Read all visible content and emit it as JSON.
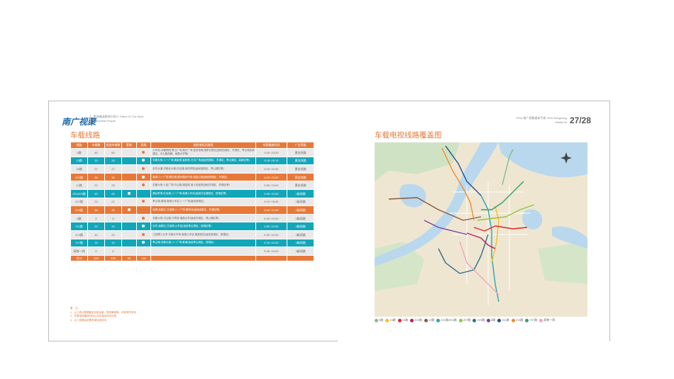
{
  "left_page": {
    "logo": "南广视聚",
    "logo_sub": "影响最具影响力的人 Effect Of The Most Influential People",
    "title": "车载线路",
    "table": {
      "headers": [
        "线路",
        "车辆数",
        "投放车辆数",
        "套装",
        "双屏",
        "途经地标及路段",
        "车载播放时间",
        "广告等级"
      ],
      "rows": [
        {
          "cls": "gray",
          "line": "5路",
          "a": "60",
          "b": "60",
          "c": "",
          "d": "●",
          "route": "火车站-动植物园-蒙山广场-鼎元广场-金亚传媒-国泰日报社(途经西湖区、东湖区、青山湖区新建区、中山路商圈、南昌大学等)",
          "time": "5:20~23:30",
          "grade": "黄金线路"
        },
        {
          "cls": "teal",
          "line": "13路",
          "a": "33",
          "b": "33",
          "c": "",
          "d": "●",
          "route": "洪都大桥-八一广场-绳金塔-省政府-万达广场(途经西湖区、东湖区、青山湖区、高新区等)",
          "time": "5:15~20:10",
          "grade": "黄金线路"
        },
        {
          "cls": "gray",
          "line": "16路",
          "a": "37",
          "b": "27",
          "c": "",
          "d": "●",
          "route": "京东大道-洪都北大道-红谷滩-省体育馆(途经高新区、青山湖区等)",
          "time": "6:10~22:30",
          "grade": "黄金线路"
        },
        {
          "cls": "orange",
          "line": "202路",
          "a": "30",
          "b": "30",
          "c": "",
          "d": "●",
          "route": "象湖-八一广场-滕王阁-胜利路步行街-瑞金公园(途经西湖区、东湖区)",
          "time": "6:15~22:30",
          "grade": "黄金线路"
        },
        {
          "cls": "gray",
          "line": "12路",
          "a": "22",
          "b": "25",
          "c": "",
          "d": "●",
          "route": "洪都大桥-人民广场-中山路-绳金塔-省人民医院(途经东湖区、西湖区等)",
          "time": "5:50~19:00",
          "grade": "黄金线路"
        },
        {
          "cls": "teal",
          "line": "201/203路",
          "a": "63",
          "b": "63",
          "c": "●",
          "d": "",
          "route": "昌北机场-红谷滩-八一广场-南昌火车站(途经红谷滩新区、西湖区等)",
          "time": "5:30~24:30",
          "grade": "1级线路"
        },
        {
          "cls": "gray",
          "line": "207路",
          "a": "24",
          "b": "21",
          "c": "",
          "d": "●",
          "route": "青云谱-象湖-南昌火车站-八一广场(途经西湖区)",
          "time": "6:10~18:30",
          "grade": "1级线路"
        },
        {
          "cls": "orange",
          "line": "219路",
          "a": "36",
          "b": "36",
          "c": "●",
          "d": "",
          "route": "瑶湖-高新区-艾溪湖-八一广场-朝阳洲(途经高新区、东湖区等)",
          "time": "5:40~21:00",
          "grade": "2级线路"
        },
        {
          "cls": "gray",
          "line": "8路",
          "a": "8",
          "b": "8",
          "c": "",
          "d": "●",
          "route": "洪都大桥-中山路-万寿宫-南昌大学(途经东湖区、青山湖区等)",
          "time": "6:20~19:30",
          "grade": "2级线路"
        },
        {
          "cls": "teal",
          "line": "211路",
          "a": "20",
          "b": "20",
          "c": "",
          "d": "●",
          "route": "京东-高新区-艾溪湖-火车站(途经青山湖区、西湖区等)",
          "time": "5:50~22:30",
          "grade": "3级线路"
        },
        {
          "cls": "gray",
          "line": "213路",
          "a": "40",
          "b": "20",
          "c": "",
          "d": "●",
          "route": "江西理工大学-洪城大市场-南昌火车站-南昌西站(途经西湖区、新建区)",
          "time": "6:00~22:30",
          "grade": "3级线路"
        },
        {
          "cls": "teal",
          "line": "707路",
          "a": "15",
          "b": "15",
          "c": "",
          "d": "●",
          "route": "青山湖-洪都大道-八一广场-象湖(途经青山湖区、西湖区)",
          "time": "6:15~22:30",
          "grade": "3级线路"
        },
        {
          "cls": "gray",
          "line": "高铁一线",
          "a": "6",
          "b": "6",
          "c": "",
          "d": "",
          "route": "",
          "time": "5:40~23:20",
          "grade": "3级线路"
        }
      ],
      "total": {
        "line": "合计",
        "a": "396",
        "b": "339",
        "c": "99",
        "d": "118"
      }
    },
    "notes": [
      "备　注：",
      "1、以上统计数据截至目前运营，受统筹调度，可能有所变动",
      "2、车载电视播放时间以实际营运时间为准",
      "3、以上线路会依需求增加或变动"
    ]
  },
  "right_page": {
    "header_year": "2016 南广视聚媒体手册 2016 Nanguang Media Kit",
    "page_number": "27/28",
    "title": "车载电视线路覆盖图",
    "legend": [
      {
        "label": "5路",
        "color": "#7bbf8a"
      },
      {
        "label": "13路",
        "color": "#f2c21b"
      },
      {
        "label": "16路",
        "color": "#e3242b"
      },
      {
        "label": "202路",
        "color": "#c2185b"
      },
      {
        "label": "12路",
        "color": "#8a5a3c"
      },
      {
        "label": "201路/203路",
        "color": "#26a6b8"
      },
      {
        "label": "207路",
        "color": "#8dc63f"
      },
      {
        "label": "219路",
        "color": "#2f6f8f"
      },
      {
        "label": "8路",
        "color": "#7b3f98"
      },
      {
        "label": "211路",
        "color": "#1f4e8c"
      },
      {
        "label": "213路",
        "color": "#f08c2a"
      },
      {
        "label": "707路",
        "color": "#3a9e68"
      },
      {
        "label": "高铁一线",
        "color": "#f3a5b8"
      }
    ]
  }
}
